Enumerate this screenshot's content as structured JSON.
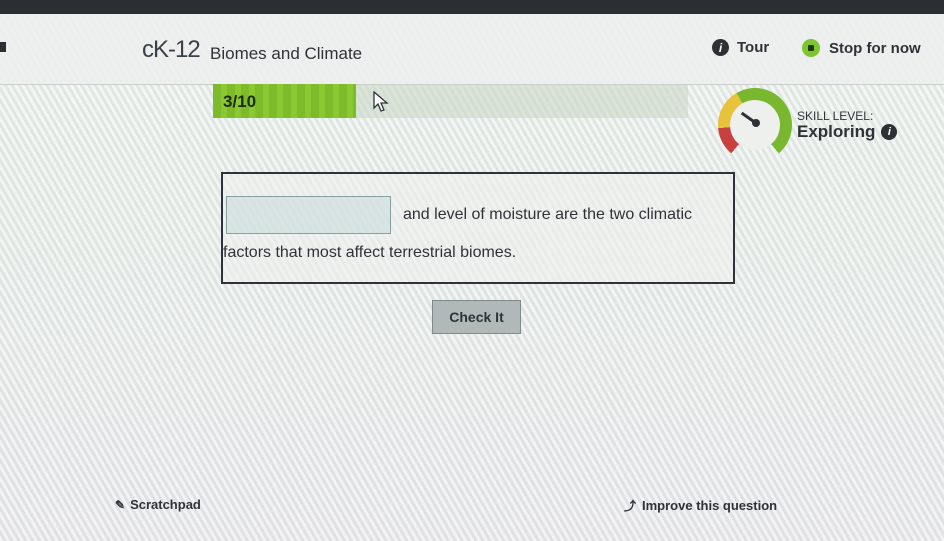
{
  "header": {
    "logo": "cK-12",
    "title": "Biomes and Climate",
    "tour_label": "Tour",
    "stop_label": "Stop for now"
  },
  "progress": {
    "label": "3/10",
    "fraction": 0.3
  },
  "skill": {
    "label": "SKILL LEVEL:",
    "value": "Exploring"
  },
  "question": {
    "answer_value": "",
    "line1": "and level of moisture are the two climatic",
    "line2": "factors that most affect terrestrial biomes."
  },
  "actions": {
    "check_label": "Check It"
  },
  "footer": {
    "scratchpad_label": "Scratchpad",
    "improve_label": "Improve this question"
  },
  "colors": {
    "accent_green": "#7ec52f",
    "progress_green": "#7dbb2a",
    "text_dark": "#2f3338"
  }
}
